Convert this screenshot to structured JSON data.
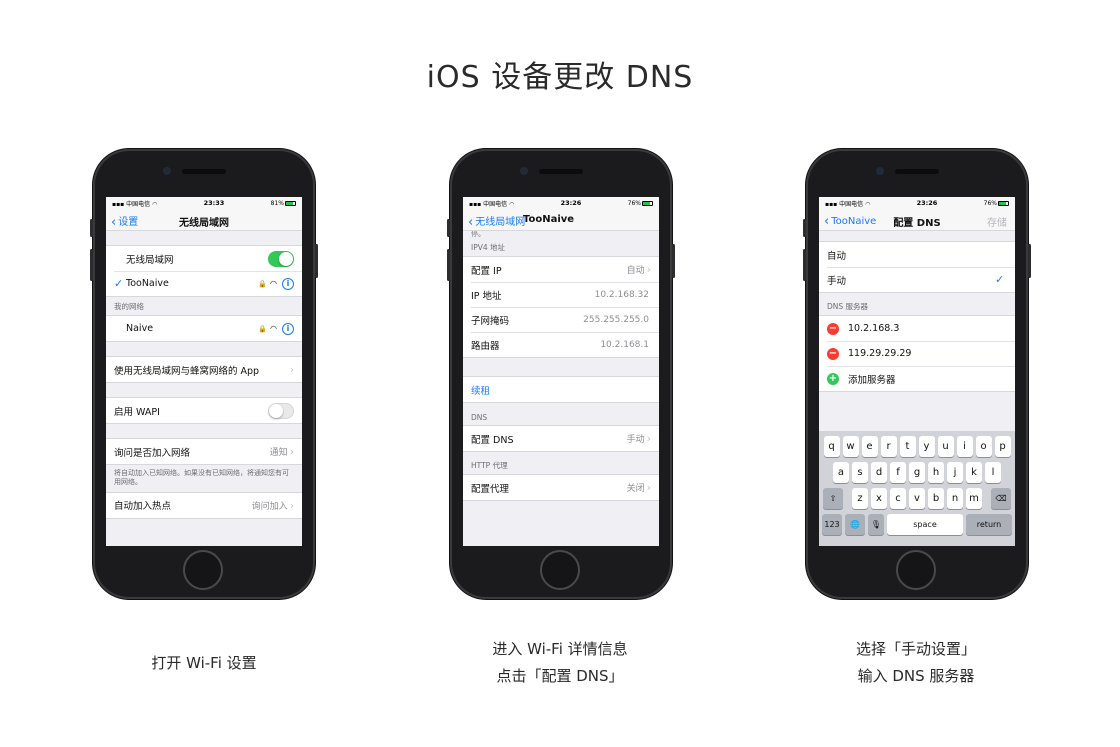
{
  "page_title": "iOS 设备更改 DNS",
  "colors": {
    "ios_blue": "#1a7bf2",
    "switch_green": "#34c759",
    "delete_red": "#ff3b30"
  },
  "phones": [
    {
      "status": {
        "carrier": "中国电信",
        "time": "23:33",
        "battery": "81%",
        "battery_level": 0.81
      },
      "nav": {
        "back": "设置",
        "title": "无线局域网"
      },
      "wifi_label": "无线局域网",
      "current_network": "TooNaive",
      "my_networks_header": "我的网络",
      "my_network": "Naive",
      "app_row": "使用无线局域网与蜂窝网络的 App",
      "wapi_label": "启用 WAPI",
      "ask_join_label": "询问是否加入网络",
      "ask_join_value": "通知",
      "ask_join_footer": "将自动加入已知网络。如果没有已知网络，将通知您有可用网络。",
      "auto_hotspot_label": "自动加入热点",
      "auto_hotspot_value": "询问加入"
    },
    {
      "status": {
        "carrier": "中国电信",
        "time": "23:26",
        "battery": "76%",
        "battery_level": 0.76
      },
      "nav": {
        "back": "无线局域网",
        "title": "TooNaive"
      },
      "cut_text": "停。",
      "ipv4_header": "IPV4 地址",
      "rows": [
        {
          "label": "配置 IP",
          "value": "自动"
        },
        {
          "label": "IP 地址",
          "value": "10.2.168.32"
        },
        {
          "label": "子网掩码",
          "value": "255.255.255.0"
        },
        {
          "label": "路由器",
          "value": "10.2.168.1"
        }
      ],
      "renew": "续租",
      "dns_header": "DNS",
      "dns_row": {
        "label": "配置 DNS",
        "value": "手动"
      },
      "proxy_header": "HTTP 代理",
      "proxy_row": {
        "label": "配置代理",
        "value": "关闭"
      }
    },
    {
      "status": {
        "carrier": "中国电信",
        "time": "23:26",
        "battery": "76%",
        "battery_level": 0.76
      },
      "nav": {
        "back": "TooNaive",
        "title": "配置 DNS",
        "save": "存储"
      },
      "mode_auto": "自动",
      "mode_manual": "手动",
      "dns_servers_header": "DNS 服务器",
      "servers": [
        "10.2.168.3",
        "119.29.29.29"
      ],
      "add_server": "添加服务器",
      "keyboard": {
        "row1": [
          "q",
          "w",
          "e",
          "r",
          "t",
          "y",
          "u",
          "i",
          "o",
          "p"
        ],
        "row2": [
          "a",
          "s",
          "d",
          "f",
          "g",
          "h",
          "j",
          "k",
          "l"
        ],
        "row3": [
          "z",
          "x",
          "c",
          "v",
          "b",
          "n",
          "m"
        ],
        "shift": "⇧",
        "backspace": "⌫",
        "numbers": "123",
        "globe": "🌐",
        "mic": "🎙",
        "space": "space",
        "return": "return"
      }
    }
  ],
  "captions": [
    [
      "打开 Wi-Fi 设置"
    ],
    [
      "进入 Wi-Fi 详情信息",
      "点击「配置 DNS」"
    ],
    [
      "选择「手动设置」",
      "输入 DNS 服务器"
    ]
  ]
}
